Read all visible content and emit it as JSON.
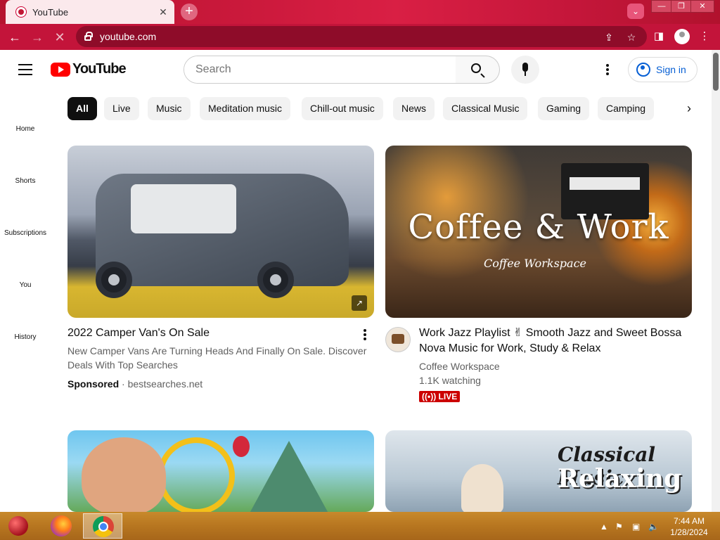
{
  "browser": {
    "tab_title": "YouTube",
    "tab_close": "✕",
    "new_tab": "+",
    "url": "youtube.com",
    "window_controls": [
      "minimize",
      "restore",
      "close"
    ]
  },
  "youtube": {
    "logo_text": "YouTube",
    "search_placeholder": "Search",
    "sign_in": "Sign in",
    "sidebar": [
      {
        "label": "Home"
      },
      {
        "label": "Shorts"
      },
      {
        "label": "Subscriptions"
      },
      {
        "label": "You"
      },
      {
        "label": "History"
      }
    ],
    "chips": [
      "All",
      "Live",
      "Music",
      "Meditation music",
      "Chill-out music",
      "News",
      "Classical Music",
      "Gaming",
      "Camping"
    ],
    "videos": [
      {
        "title": "2022 Camper Van's On Sale",
        "description": "New Camper Vans Are Turning Heads And Finally On Sale. Discover Deals With Top Searches",
        "sponsored_label": "Sponsored",
        "sponsor_domain": "· bestsearches.net"
      },
      {
        "thumb_title": "Coffee & Work",
        "thumb_subtitle": "Coffee Workspace",
        "title": "Work Jazz Playlist ✌ Smooth Jazz and Sweet Bossa Nova Music for Work, Study & Relax",
        "channel": "Coffee Workspace",
        "views": "1.1K watching",
        "live_label": "LIVE"
      },
      {
        "thumb_line1": "Classical Music",
        "thumb_line2": "Relaxing"
      }
    ]
  },
  "taskbar": {
    "time": "7:44 AM",
    "date": "1/28/2024"
  }
}
